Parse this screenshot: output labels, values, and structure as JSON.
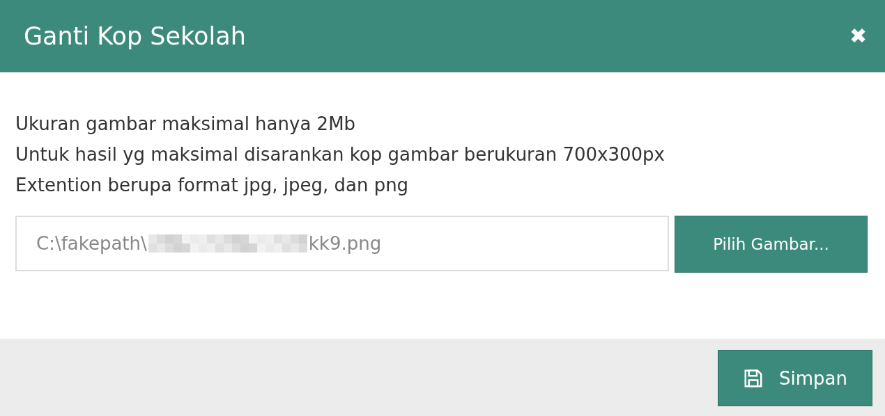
{
  "dialog": {
    "title": "Ganti Kop Sekolah",
    "close_label": "✖"
  },
  "notes": [
    "Ukuran gambar maksimal hanya 2Mb",
    "Untuk hasil yg maksimal disarankan kop gambar berukuran 700x300px",
    "Extention berupa format jpg, jpeg, dan png"
  ],
  "file_field": {
    "value_start": "C:\\fakepath\\",
    "value_end": "kk9.png",
    "button": "Pilih Gambar..."
  },
  "footer": {
    "buttons": [
      {
        "label": "Simpan",
        "kind": "save"
      }
    ]
  }
}
